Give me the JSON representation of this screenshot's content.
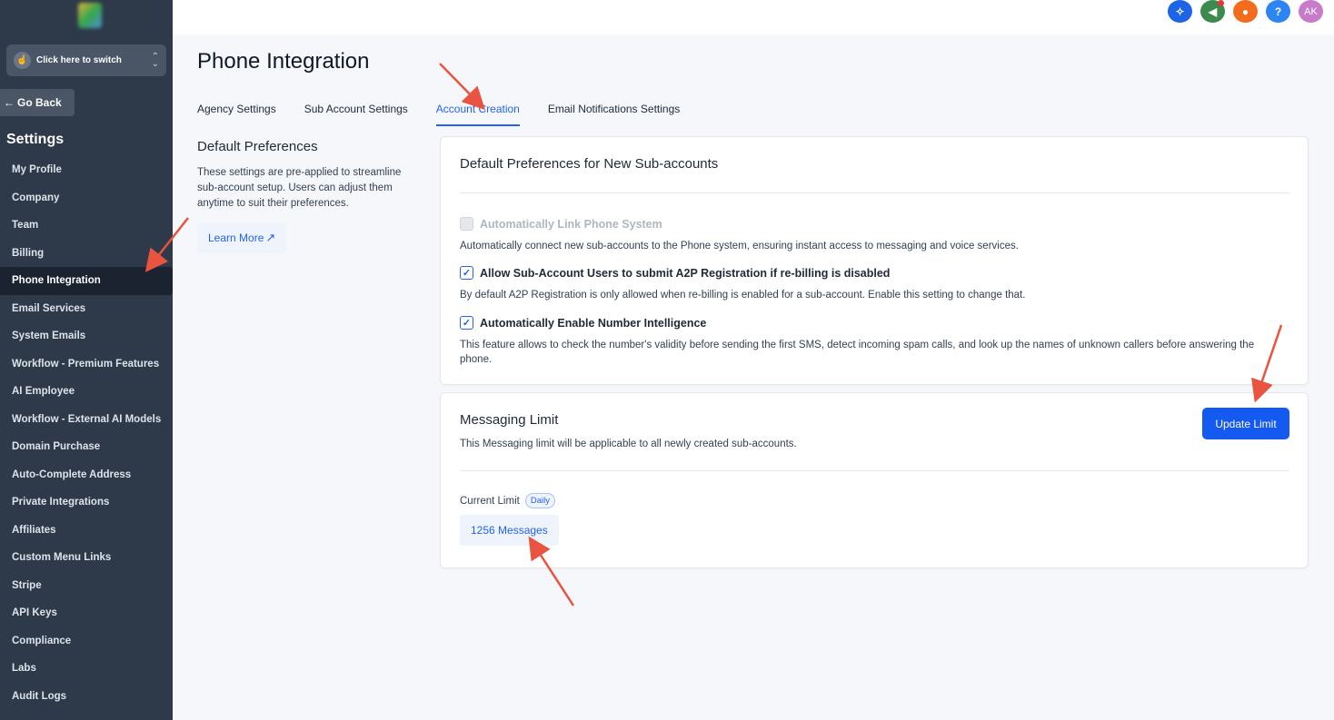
{
  "sidebar": {
    "switcher_label": "Click here to switch",
    "go_back": "Go Back",
    "settings_title": "Settings",
    "items": [
      {
        "label": "My Profile",
        "active": false
      },
      {
        "label": "Company",
        "active": false
      },
      {
        "label": "Team",
        "active": false
      },
      {
        "label": "Billing",
        "active": false
      },
      {
        "label": "Phone Integration",
        "active": true
      },
      {
        "label": "Email Services",
        "active": false
      },
      {
        "label": "System Emails",
        "active": false
      },
      {
        "label": "Workflow - Premium Features",
        "active": false
      },
      {
        "label": "AI Employee",
        "active": false
      },
      {
        "label": "Workflow - External AI Models",
        "active": false
      },
      {
        "label": "Domain Purchase",
        "active": false
      },
      {
        "label": "Auto-Complete Address",
        "active": false
      },
      {
        "label": "Private Integrations",
        "active": false
      },
      {
        "label": "Affiliates",
        "active": false
      },
      {
        "label": "Custom Menu Links",
        "active": false
      },
      {
        "label": "Stripe",
        "active": false
      },
      {
        "label": "API Keys",
        "active": false
      },
      {
        "label": "Compliance",
        "active": false
      },
      {
        "label": "Labs",
        "active": false
      },
      {
        "label": "Audit Logs",
        "active": false
      }
    ]
  },
  "topbar": {
    "help_glyph": "?",
    "avatar_initials": "AK"
  },
  "page": {
    "title": "Phone Integration",
    "tabs": [
      {
        "label": "Agency Settings",
        "active": false
      },
      {
        "label": "Sub Account Settings",
        "active": false
      },
      {
        "label": "Account Creation",
        "active": true
      },
      {
        "label": "Email Notifications Settings",
        "active": false
      }
    ]
  },
  "left": {
    "heading": "Default Preferences",
    "description": "These settings are pre-applied to streamline sub-account setup. Users can adjust them anytime to suit their preferences.",
    "learn_more": "Learn More"
  },
  "preferences_card": {
    "title": "Default Preferences for New Sub-accounts",
    "options": [
      {
        "label": "Automatically Link Phone System",
        "checked": false,
        "disabled": true,
        "description": "Automatically connect new sub-accounts to the Phone system, ensuring instant access to messaging and voice services."
      },
      {
        "label": "Allow Sub-Account Users to submit A2P Registration if re-billing is disabled",
        "checked": true,
        "disabled": false,
        "description": "By default A2P Registration is only allowed when re-billing is enabled for a sub-account. Enable this setting to change that."
      },
      {
        "label": "Automatically Enable Number Intelligence",
        "checked": true,
        "disabled": false,
        "description": "This feature allows to check the number's validity before sending the first SMS, detect incoming spam calls, and look up the names of unknown callers before answering the phone."
      }
    ]
  },
  "messaging_card": {
    "title": "Messaging Limit",
    "subtitle": "This Messaging limit will be applicable to all newly created sub-accounts.",
    "update_button": "Update Limit",
    "current_limit_label": "Current Limit",
    "period_badge": "Daily",
    "limit_value": "1256 Messages"
  },
  "colors": {
    "sidebar_bg": "#2e3949",
    "accent": "#2463eb",
    "annotation_arrow": "#e8543f"
  }
}
